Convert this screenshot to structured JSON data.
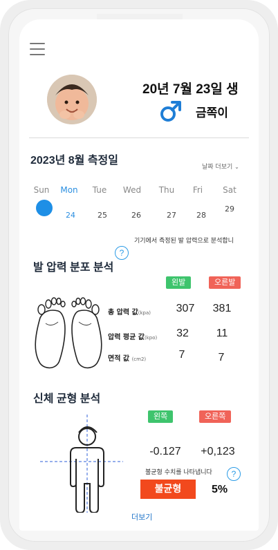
{
  "profile": {
    "birth": "20년 7월 23일 생",
    "name": "금쪽이",
    "gender_icon": "male-icon"
  },
  "measure": {
    "title": "2023년 8월 측정일",
    "more_dates": "날짜 더보기",
    "days": [
      "Sun",
      "Mon",
      "Tue",
      "Wed",
      "Thu",
      "Fri",
      "Sat"
    ],
    "dates": [
      "24",
      "25",
      "26",
      "27",
      "28",
      "29"
    ],
    "note": "기기에서 측정된 발 압력으로 분석합니"
  },
  "pressure": {
    "title": "발 압력 분포 분석",
    "left": "왼발",
    "right": "오른발",
    "total": {
      "label": "총 압력 값",
      "unit": "(kpa)",
      "left": "307",
      "right": "381"
    },
    "avg": {
      "label": "압력 평균 값",
      "unit": "(kpo)",
      "left": "32",
      "right": "11"
    },
    "area": {
      "label": "면적 값",
      "unit": "(cm2)",
      "left": "7",
      "right": "7"
    }
  },
  "balance": {
    "title": "신체 균형 분석",
    "left": "왼쪽",
    "right": "오른쪽",
    "left_value": "-0.127",
    "right_value": "+0,123",
    "note": "불균형 수치를 나타냅니다",
    "status": "불균형",
    "percent": "5%",
    "more": "더보기"
  },
  "colors": {
    "accent": "#1e8fe6",
    "green": "#3ec46d",
    "red": "#f06358",
    "status": "#f2491d"
  }
}
